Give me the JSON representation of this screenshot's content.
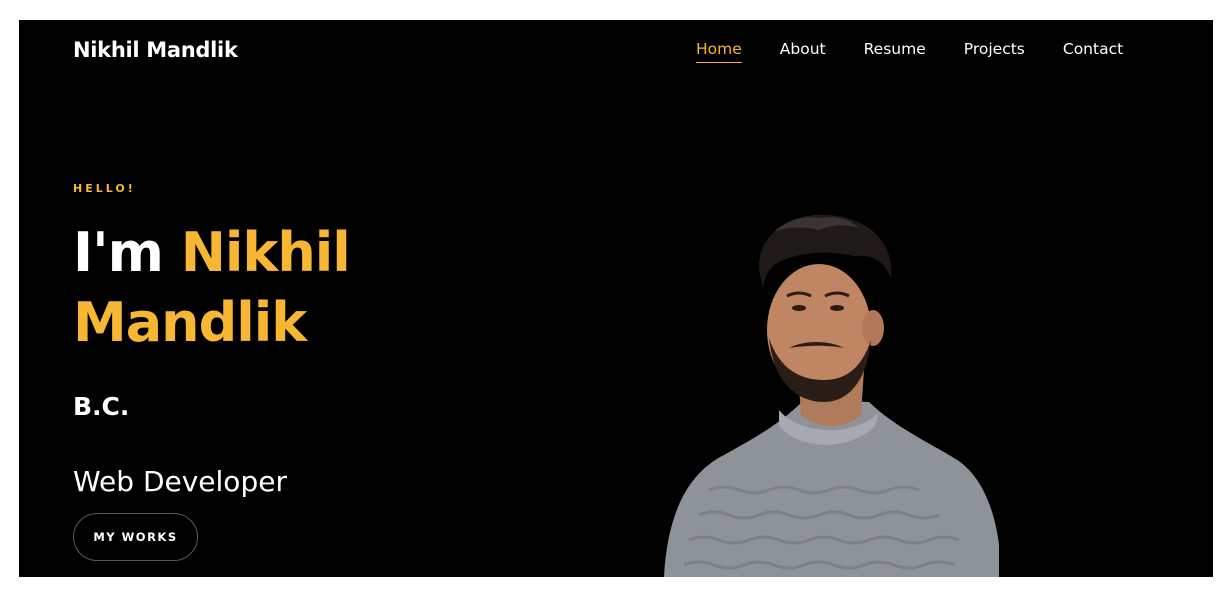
{
  "header": {
    "brand": "Nikhil Mandlik",
    "nav": [
      {
        "label": "Home",
        "active": true
      },
      {
        "label": "About",
        "active": false
      },
      {
        "label": "Resume",
        "active": false
      },
      {
        "label": "Projects",
        "active": false
      },
      {
        "label": "Contact",
        "active": false
      }
    ]
  },
  "hero": {
    "greeting": "HELLO!",
    "intro": "I'm",
    "name_first": "Nikhil",
    "name_last": "Mandlik",
    "role_short": "B.C.",
    "role_long": "Web Developer",
    "cta_label": "MY WORKS"
  },
  "colors": {
    "accent": "#f7b733",
    "background": "#000000",
    "text": "#ffffff"
  },
  "icons": {
    "portrait": "person-portrait-photo"
  }
}
